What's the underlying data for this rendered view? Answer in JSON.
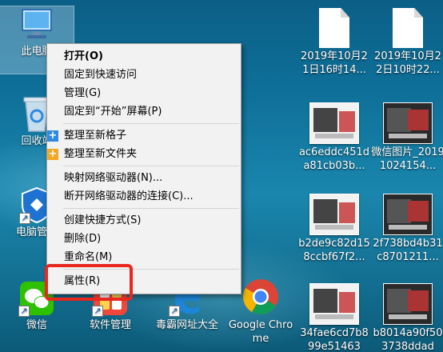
{
  "desktop": {
    "icons": [
      {
        "label": "此电脑",
        "icon": "computer-icon"
      },
      {
        "label": "回收站",
        "icon": "recycle-bin-icon"
      },
      {
        "label": "电脑管家",
        "icon": "shield-icon"
      },
      {
        "label": "微信",
        "icon": "wechat-icon"
      },
      {
        "label": "软件管理",
        "icon": "software-manager-icon"
      },
      {
        "label": "毒霸网址大全",
        "icon": "edge-icon"
      },
      {
        "label": "Google Chrome",
        "icon": "chrome-icon"
      },
      {
        "label": "2019年10月21日16时14...",
        "icon": "document-icon"
      },
      {
        "label": "2019年10月22日10时22...",
        "icon": "document-icon"
      },
      {
        "label": "ac6eddc451da81cb03b...",
        "icon": "image-thumbnail"
      },
      {
        "label": "微信图片_20191024154...",
        "icon": "image-thumbnail"
      },
      {
        "label": "b2de9c82d158ccbf67f2...",
        "icon": "image-thumbnail"
      },
      {
        "label": "2f738bd4b31c8701211...",
        "icon": "image-thumbnail"
      },
      {
        "label": "34fae6cd7b899e51463",
        "icon": "image-thumbnail"
      },
      {
        "label": "b8014a90f503738ddad",
        "icon": "image-thumbnail"
      }
    ]
  },
  "context_menu": {
    "items": [
      {
        "label": "打开(O)",
        "bold": true
      },
      {
        "label": "固定到快速访问"
      },
      {
        "label": "管理(G)"
      },
      {
        "label": "固定到“开始”屏幕(P)"
      },
      {
        "label": "整理至新格子",
        "icon": "plus-blue-icon"
      },
      {
        "label": "整理至新文件夹",
        "icon": "plus-orange-icon"
      },
      {
        "label": "映射网络驱动器(N)..."
      },
      {
        "label": "断开网络驱动器的连接(C)..."
      },
      {
        "label": "创建快捷方式(S)"
      },
      {
        "label": "删除(D)"
      },
      {
        "label": "重命名(M)"
      },
      {
        "label": "属性(R)"
      }
    ]
  },
  "colors": {
    "highlight": "#e8271f",
    "menu_bg": "#f2f2f2",
    "plus_blue": "#2d8ae0",
    "plus_orange": "#f5a623"
  }
}
